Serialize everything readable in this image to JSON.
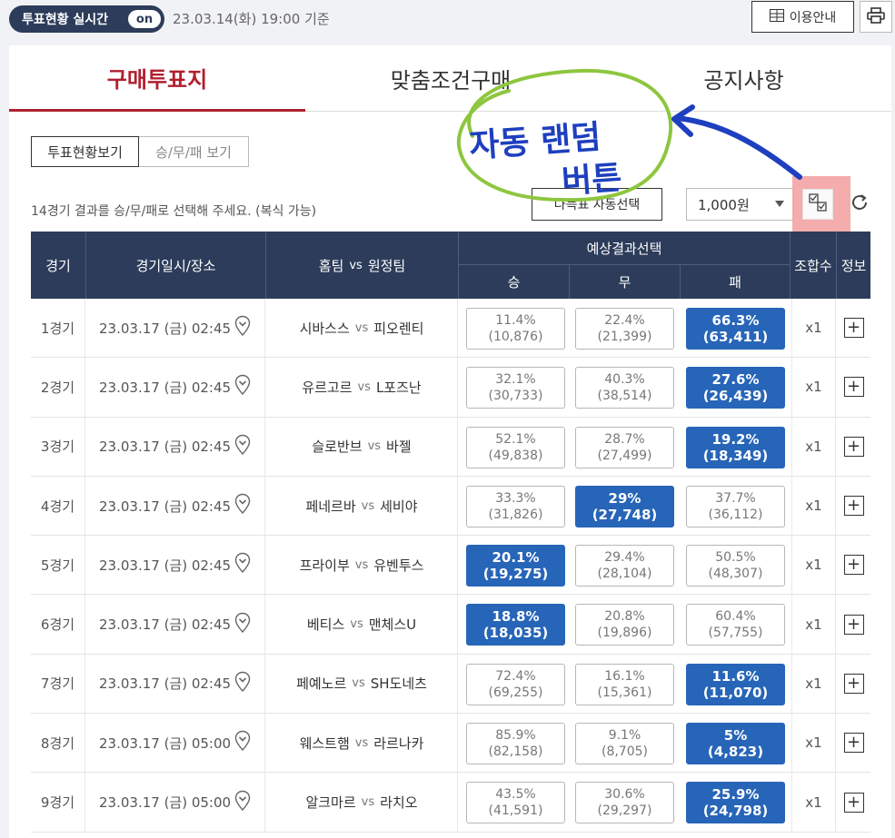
{
  "topbar": {
    "live_label": "투표현황 실시간",
    "on_label": "on",
    "timestamp": "23.03.14(화) 19:00 기준",
    "guide_label": "이용안내"
  },
  "tabs": [
    {
      "label": "구매투표지",
      "active": true
    },
    {
      "label": "맞춤조건구매",
      "active": false
    },
    {
      "label": "공지사항",
      "active": false
    }
  ],
  "view_toggle": {
    "status_view": "투표현황보기",
    "wdl_view": "승/무/패 보기"
  },
  "instruction": "14경기 결과를 승/무/패로 선택해 주세요. (복식 가능)",
  "controls": {
    "auto_select_label": "나득표 자동선택",
    "amount": "1,000원"
  },
  "annotation": {
    "line1": "자동 랜덤",
    "line2": "버튼"
  },
  "table": {
    "headers": {
      "game": "경기",
      "datetime": "경기일시/장소",
      "teams_home": "홈팀",
      "teams_vs": "vs",
      "teams_away": "원정팀",
      "prediction": "예상결과선택",
      "win": "승",
      "draw": "무",
      "lose": "패",
      "combo": "조합수",
      "info": "정보"
    },
    "rows": [
      {
        "no": "1경기",
        "date": "23.03.17 (금) 02:45",
        "home": "시바스스",
        "vs": "vs",
        "away": "피오렌티",
        "w_pct": "11.4%",
        "w_cnt": "(10,876)",
        "d_pct": "22.4%",
        "d_cnt": "(21,399)",
        "l_pct": "66.3%",
        "l_cnt": "(63,411)",
        "sel": "l",
        "combo": "x1",
        "info": "+"
      },
      {
        "no": "2경기",
        "date": "23.03.17 (금) 02:45",
        "home": "유르고르",
        "vs": "vs",
        "away": "L포즈난",
        "w_pct": "32.1%",
        "w_cnt": "(30,733)",
        "d_pct": "40.3%",
        "d_cnt": "(38,514)",
        "l_pct": "27.6%",
        "l_cnt": "(26,439)",
        "sel": "l",
        "combo": "x1",
        "info": "+"
      },
      {
        "no": "3경기",
        "date": "23.03.17 (금) 02:45",
        "home": "슬로반브",
        "vs": "vs",
        "away": "바젤",
        "w_pct": "52.1%",
        "w_cnt": "(49,838)",
        "d_pct": "28.7%",
        "d_cnt": "(27,499)",
        "l_pct": "19.2%",
        "l_cnt": "(18,349)",
        "sel": "l",
        "combo": "x1",
        "info": "+"
      },
      {
        "no": "4경기",
        "date": "23.03.17 (금) 02:45",
        "home": "페네르바",
        "vs": "vs",
        "away": "세비야",
        "w_pct": "33.3%",
        "w_cnt": "(31,826)",
        "d_pct": "29%",
        "d_cnt": "(27,748)",
        "l_pct": "37.7%",
        "l_cnt": "(36,112)",
        "sel": "d",
        "combo": "x1",
        "info": "+"
      },
      {
        "no": "5경기",
        "date": "23.03.17 (금) 02:45",
        "home": "프라이부",
        "vs": "vs",
        "away": "유벤투스",
        "w_pct": "20.1%",
        "w_cnt": "(19,275)",
        "d_pct": "29.4%",
        "d_cnt": "(28,104)",
        "l_pct": "50.5%",
        "l_cnt": "(48,307)",
        "sel": "w",
        "combo": "x1",
        "info": "+"
      },
      {
        "no": "6경기",
        "date": "23.03.17 (금) 02:45",
        "home": "베티스",
        "vs": "vs",
        "away": "맨체스U",
        "w_pct": "18.8%",
        "w_cnt": "(18,035)",
        "d_pct": "20.8%",
        "d_cnt": "(19,896)",
        "l_pct": "60.4%",
        "l_cnt": "(57,755)",
        "sel": "w",
        "combo": "x1",
        "info": "+"
      },
      {
        "no": "7경기",
        "date": "23.03.17 (금) 02:45",
        "home": "페예노르",
        "vs": "vs",
        "away": "SH도네츠",
        "w_pct": "72.4%",
        "w_cnt": "(69,255)",
        "d_pct": "16.1%",
        "d_cnt": "(15,361)",
        "l_pct": "11.6%",
        "l_cnt": "(11,070)",
        "sel": "l",
        "combo": "x1",
        "info": "+"
      },
      {
        "no": "8경기",
        "date": "23.03.17 (금) 05:00",
        "home": "웨스트햄",
        "vs": "vs",
        "away": "라르나카",
        "w_pct": "85.9%",
        "w_cnt": "(82,158)",
        "d_pct": "9.1%",
        "d_cnt": "(8,705)",
        "l_pct": "5%",
        "l_cnt": "(4,823)",
        "sel": "l",
        "combo": "x1",
        "info": "+"
      },
      {
        "no": "9경기",
        "date": "23.03.17 (금) 05:00",
        "home": "알크마르",
        "vs": "vs",
        "away": "라치오",
        "w_pct": "43.5%",
        "w_cnt": "(41,591)",
        "d_pct": "30.6%",
        "d_cnt": "(29,297)",
        "l_pct": "25.9%",
        "l_cnt": "(24,798)",
        "sel": "l",
        "combo": "x1",
        "info": "+"
      }
    ]
  },
  "icons": {
    "guide": "grid-list-icon",
    "print": "printer-icon",
    "pin": "location-pin-icon",
    "random": "random-check-icon",
    "refresh": "refresh-icon"
  },
  "colors": {
    "navy": "#2c3c5a",
    "accent_red": "#b0202f",
    "selected_blue": "#2765b8",
    "annotation_green": "#8dc63f",
    "annotation_blue": "#1e3fbf",
    "highlight_pink": "#f4a3a3"
  }
}
